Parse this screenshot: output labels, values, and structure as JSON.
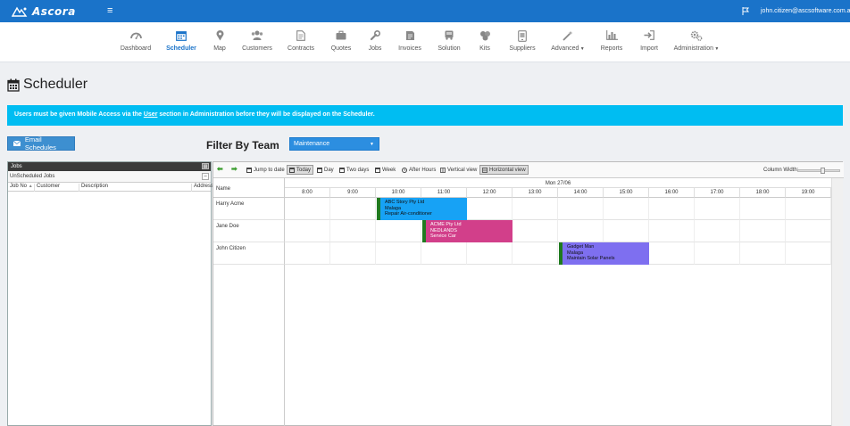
{
  "app": {
    "logo_text": "Ascora",
    "user_email": "john.citizen@ascsoftware.com.au"
  },
  "nav": [
    {
      "label": "Dashboard",
      "icon": "dashboard-icon",
      "active": false
    },
    {
      "label": "Scheduler",
      "icon": "calendar-icon",
      "active": true
    },
    {
      "label": "Map",
      "icon": "map-pin-icon",
      "active": false
    },
    {
      "label": "Customers",
      "icon": "customers-icon",
      "active": false
    },
    {
      "label": "Contracts",
      "icon": "contract-icon",
      "active": false
    },
    {
      "label": "Quotes",
      "icon": "briefcase-icon",
      "active": false
    },
    {
      "label": "Jobs",
      "icon": "wrench-icon",
      "active": false
    },
    {
      "label": "Invoices",
      "icon": "invoice-icon",
      "active": false
    },
    {
      "label": "Solution",
      "icon": "truck-icon",
      "active": false
    },
    {
      "label": "Kits",
      "icon": "kits-icon",
      "active": false
    },
    {
      "label": "Suppliers",
      "icon": "suppliers-icon",
      "active": false
    },
    {
      "label": "Advanced",
      "icon": "magic-wand-icon",
      "active": false,
      "dropdown": true
    },
    {
      "label": "Reports",
      "icon": "bar-chart-icon",
      "active": false
    },
    {
      "label": "Import",
      "icon": "import-icon",
      "active": false
    },
    {
      "label": "Administration",
      "icon": "cogs-icon",
      "active": false,
      "dropdown": true
    }
  ],
  "page": {
    "title": "Scheduler"
  },
  "alert": {
    "before": "Users must be given Mobile Access via the ",
    "link": "User",
    "after": " section in Administration before they will be displayed on the Scheduler."
  },
  "email_button": "Email Schedules",
  "filter": {
    "label": "Filter By Team",
    "value": "Maintenance"
  },
  "jobs_panel": {
    "title": "Jobs",
    "subtitle": "UnScheduled Jobs",
    "columns": [
      "Job No",
      "Customer",
      "Description",
      "Address"
    ]
  },
  "toolbar": {
    "jump": "Jump to date",
    "today": "Today",
    "day": "Day",
    "two_days": "Two days",
    "week": "Week",
    "after_hours": "After Hours",
    "vertical": "Vertical view",
    "horizontal": "Horizontal view",
    "column_width": "Column Width:"
  },
  "schedule": {
    "name_header": "Name",
    "date": "Mon 27/06",
    "hours": [
      "8:00",
      "9:00",
      "10:00",
      "11:00",
      "12:00",
      "13:00",
      "14:00",
      "15:00",
      "16:00",
      "17:00",
      "18:00",
      "19:00"
    ],
    "resources": [
      "Harry Acme",
      "Jane Doe",
      "John Citizen"
    ],
    "events": [
      {
        "row": 0,
        "start": 10,
        "end": 12,
        "color": "#17a2f5",
        "lines": [
          "ABC Story Pty Ltd",
          "Malaga",
          "Repair Air-conditioner"
        ]
      },
      {
        "row": 1,
        "start": 11,
        "end": 13,
        "color": "#d23f8a",
        "lines": [
          "ACME Pty Ltd",
          "NEDLANDS",
          "Service Car"
        ]
      },
      {
        "row": 2,
        "start": 14,
        "end": 16,
        "color": "#7e6ff0",
        "lines": [
          "Gadget Man",
          "Malaga",
          "Maintain Solar Panels"
        ]
      }
    ]
  }
}
